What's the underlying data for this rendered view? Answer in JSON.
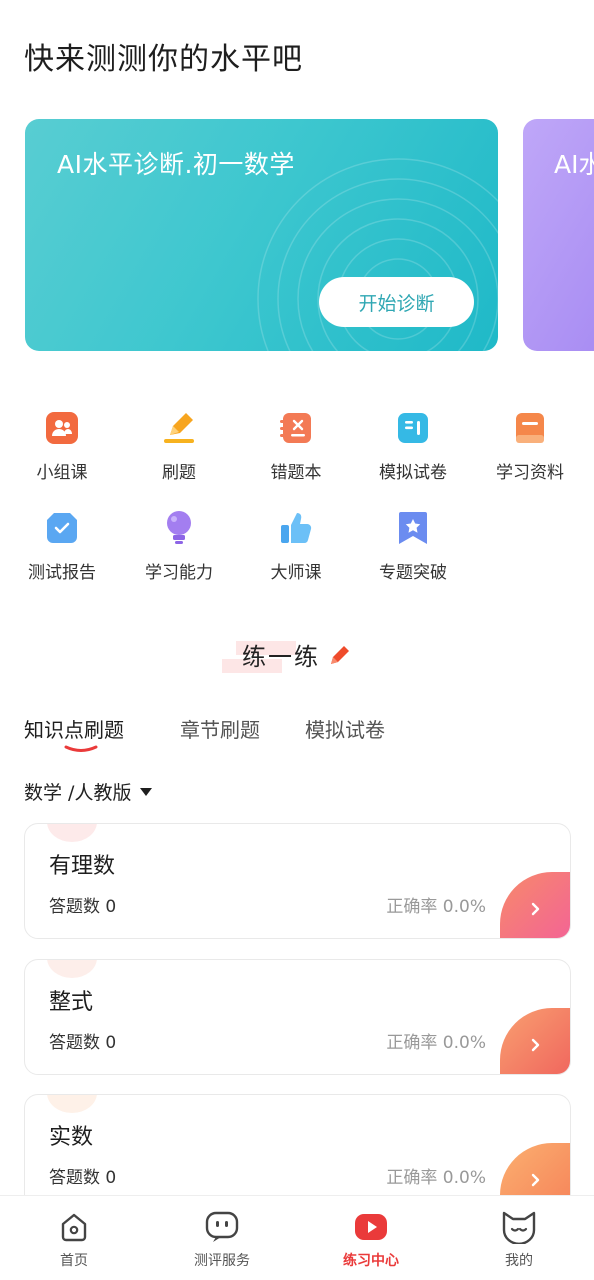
{
  "header": {
    "title": "快来测测你的水平吧"
  },
  "banner": {
    "title": "AI水平诊断.初一数学",
    "button_label": "开始诊断",
    "next_title_partial": "AI水"
  },
  "grid": [
    {
      "label": "小组课",
      "icon": "group-class-icon"
    },
    {
      "label": "刷题",
      "icon": "pencil-icon"
    },
    {
      "label": "错题本",
      "icon": "wrong-book-icon"
    },
    {
      "label": "模拟试卷",
      "icon": "mock-paper-icon"
    },
    {
      "label": "学习资料",
      "icon": "materials-icon"
    },
    {
      "label": "测试报告",
      "icon": "report-icon"
    },
    {
      "label": "学习能力",
      "icon": "bulb-icon"
    },
    {
      "label": "大师课",
      "icon": "thumb-up-icon"
    },
    {
      "label": "专题突破",
      "icon": "bookmark-star-icon"
    }
  ],
  "section": {
    "title": "练一练"
  },
  "tabs": [
    {
      "label": "知识点刷题",
      "active": true
    },
    {
      "label": "章节刷题",
      "active": false
    },
    {
      "label": "模拟试卷",
      "active": false
    }
  ],
  "subject": {
    "label": "数学 /人教版"
  },
  "cards": [
    {
      "title": "有理数",
      "count_label": "答题数 0",
      "accuracy_label": "正确率 0.0%",
      "color_from": "#f78a6a",
      "color_to": "#f25c9e"
    },
    {
      "title": "整式",
      "count_label": "答题数 0",
      "accuracy_label": "正确率 0.0%",
      "color_from": "#f9a070",
      "color_to": "#ee5a5a"
    },
    {
      "title": "实数",
      "count_label": "答题数 0",
      "accuracy_label": "正确率 0.0%",
      "color_from": "#fbb070",
      "color_to": "#f57a55"
    }
  ],
  "bottom_nav": [
    {
      "label": "首页",
      "icon": "home-icon",
      "active": false
    },
    {
      "label": "测评服务",
      "icon": "chat-face-icon",
      "active": false
    },
    {
      "label": "练习中心",
      "icon": "play-icon",
      "active": true
    },
    {
      "label": "我的",
      "icon": "cat-face-icon",
      "active": false
    }
  ],
  "colors": {
    "accent_red": "#ea3a3a",
    "teal": "#3ec7cf",
    "purple": "#a68af2"
  }
}
